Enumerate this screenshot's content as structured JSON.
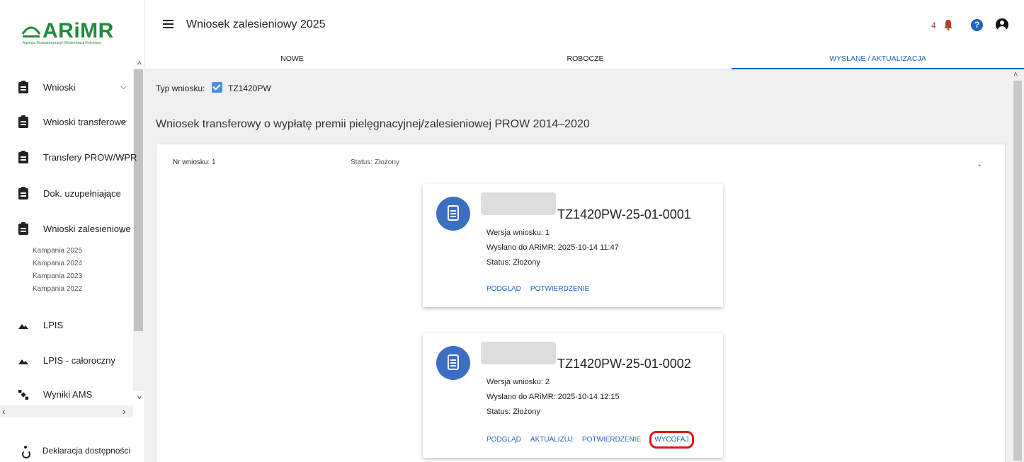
{
  "brand": {
    "name": "ARiMR",
    "subtitle": "Agencja Restrukturyzacji i Modernizacji Rolnictwa"
  },
  "sidebar": {
    "items": [
      {
        "label": "Wnioski",
        "icon": "clipboard-icon",
        "chevron": "down"
      },
      {
        "label": "Wnioski transferowe",
        "icon": "clipboard-icon",
        "chevron": "down"
      },
      {
        "label": "Transfery PROW/WPR",
        "icon": "clipboard-icon",
        "chevron": "down"
      },
      {
        "label": "Dok. uzupełniające",
        "icon": "clipboard-icon",
        "chevron": "down"
      },
      {
        "label": "Wnioski zalesieniowe",
        "icon": "clipboard-icon",
        "chevron": "up"
      },
      {
        "label": "LPIS",
        "icon": "mountain-icon",
        "chevron": ""
      },
      {
        "label": "LPIS - całoroczny",
        "icon": "mountain-icon",
        "chevron": ""
      },
      {
        "label": "Wyniki AMS",
        "icon": "satellite-icon",
        "chevron": ""
      }
    ],
    "subitems": [
      "Kampania 2025",
      "Kampania 2024",
      "Kampania 2023",
      "Kampania 2022"
    ],
    "accessibility": "Deklaracja dostępności"
  },
  "header": {
    "title": "Wniosek zalesieniowy 2025",
    "notifications_count": "4",
    "help_glyph": "?",
    "tabs": [
      {
        "label": "NOWE",
        "active": false
      },
      {
        "label": "ROBOCZE",
        "active": false
      },
      {
        "label": "WYSŁANE / AKTUALIZACJA",
        "active": true
      }
    ]
  },
  "main": {
    "type_label": "Typ wniosku:",
    "type_value": "TZ1420PW",
    "type_checked": true,
    "section_title": "Wniosek transferowy o wypłatę premii pielęgnacyjnej/zalesieniowej PROW 2014–2020",
    "panel": {
      "nr": "Nr wniosku: 1",
      "status": "Status: Złożony"
    },
    "cards": [
      {
        "title": "TZ1420PW-25-01-0001",
        "version": "Wersja wniosku: 1",
        "sent": "Wysłano do ARiMR: 2025-10-14 11:47",
        "status": "Status: Złożony",
        "actions": [
          "PODGLĄD",
          "POTWIERDZENIE"
        ]
      },
      {
        "title": "TZ1420PW-25-01-0002",
        "version": "Wersja wniosku: 2",
        "sent": "Wysłano do ARiMR: 2025-10-14 12:15",
        "status": "Status: Złożony",
        "actions": [
          "PODGLĄD",
          "AKTUALIZUJ",
          "POTWIERDZENIE"
        ],
        "highlighted_action": "WYCOFAJ"
      }
    ]
  },
  "colors": {
    "brand_green": "#1f8a3a",
    "accent_blue": "#1e63c0",
    "highlight_red": "#e01616",
    "notification_red": "#c0392b"
  }
}
